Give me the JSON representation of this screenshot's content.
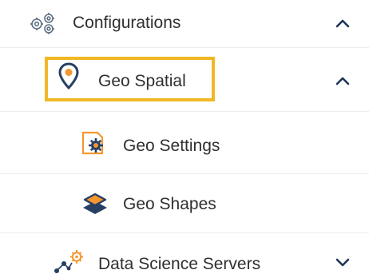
{
  "nav": {
    "configurations": {
      "label": "Configurations",
      "icon": "gears-icon",
      "state": "expanded"
    },
    "geo_spatial": {
      "label": "Geo Spatial",
      "icon": "location-pin-icon",
      "state": "expanded",
      "highlighted": true
    },
    "geo_settings": {
      "label": "Geo Settings",
      "icon": "document-gear-icon"
    },
    "geo_shapes": {
      "label": "Geo Shapes",
      "icon": "layers-icon"
    },
    "data_science_servers": {
      "label": "Data Science Servers",
      "icon": "network-gear-icon",
      "state": "collapsed"
    }
  },
  "colors": {
    "highlight_border": "#f1b825",
    "accent_orange": "#f5962f",
    "icon_navy": "#263f63",
    "text": "#2f2f2f",
    "divider": "#e9edf2"
  }
}
